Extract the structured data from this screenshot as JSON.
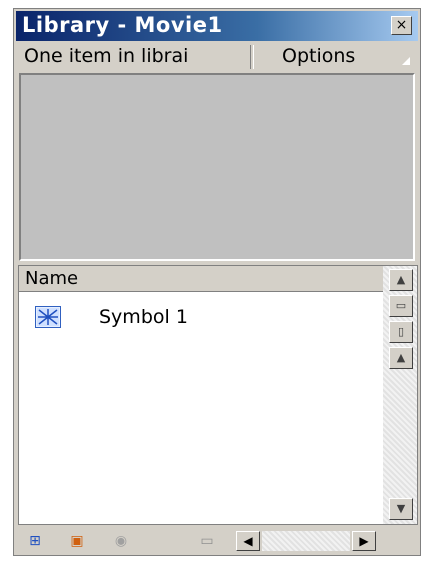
{
  "window": {
    "title": "Library - Movie1",
    "close_glyph": "×"
  },
  "info": {
    "item_count_text": "One item in librai",
    "options_label": "Options",
    "options_arrow_icon": "menu-triangle-icon"
  },
  "list": {
    "column_name": "Name",
    "items": [
      {
        "icon": "graphic-symbol-icon",
        "label": "Symbol 1"
      }
    ]
  },
  "sidebar_buttons": [
    {
      "icon": "sort-order-icon",
      "glyph": "▲"
    },
    {
      "icon": "wide-view-icon",
      "glyph": "▭"
    },
    {
      "icon": "narrow-view-icon",
      "glyph": "▯"
    },
    {
      "icon": "collapse-icon",
      "glyph": "▲"
    },
    {
      "icon": "scroll-down-icon",
      "glyph": "▼"
    }
  ],
  "toolbar": [
    {
      "icon": "new-symbol-icon",
      "glyph": "⊞"
    },
    {
      "icon": "new-folder-icon",
      "glyph": "▣"
    },
    {
      "icon": "properties-icon",
      "glyph": "◉"
    },
    {
      "icon": "delete-icon",
      "glyph": "▭"
    }
  ],
  "hscroll": {
    "left_glyph": "◀",
    "right_glyph": "▶"
  },
  "colors": {
    "title_start": "#0a246a",
    "title_end": "#a6caf0",
    "panel": "#d4d0c8",
    "preview": "#c0c0c0"
  }
}
